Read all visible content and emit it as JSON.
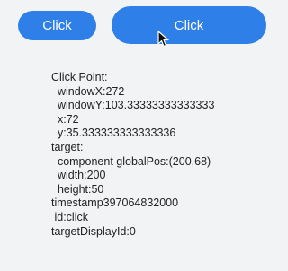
{
  "buttons": {
    "small_label": "Click",
    "large_label": "Click"
  },
  "info": {
    "lines": [
      "Click Point:",
      "  windowX:272",
      "  windowY:103.33333333333333",
      "  x:72",
      "  y:35.333333333333336",
      "target:",
      "  component globalPos:(200,68)",
      "  width:200",
      "  height:50",
      "timestamp397064832000",
      " id:click",
      "targetDisplayId:0"
    ]
  },
  "colors": {
    "button": "#2f7fe8",
    "background": "#f1f3f5",
    "text": "#222222"
  },
  "icons": {
    "cursor": "mouse-pointer-icon"
  }
}
